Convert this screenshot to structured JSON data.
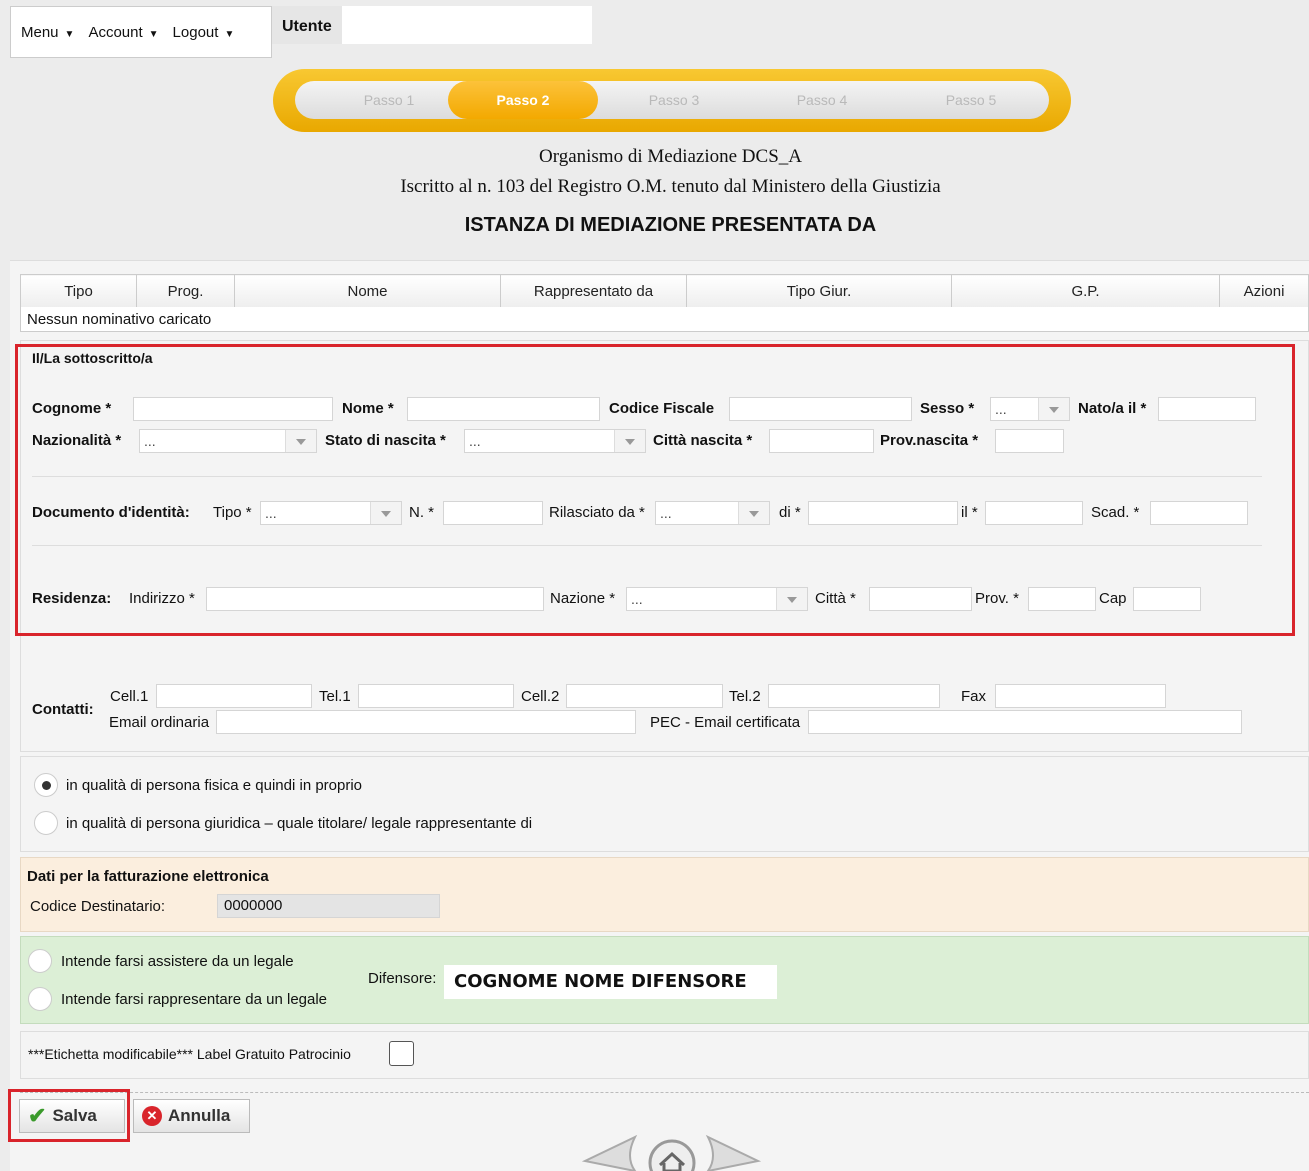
{
  "topbar": {
    "menu": "Menu",
    "account": "Account",
    "logout": "Logout",
    "utente": "Utente"
  },
  "steps": [
    "Passo 1",
    "Passo 2",
    "Passo 3",
    "Passo 4",
    "Passo 5"
  ],
  "header": {
    "line1": "Organismo di Mediazione DCS_A",
    "line2": "Iscritto al n. 103 del Registro O.M. tenuto dal Ministero della Giustizia",
    "title": "ISTANZA DI MEDIAZIONE PRESENTATA DA"
  },
  "table": {
    "columns": [
      "Tipo",
      "Prog.",
      "Nome",
      "Rappresentato da",
      "Tipo Giur.",
      "G.P.",
      "Azioni"
    ],
    "empty": "Nessun nominativo caricato"
  },
  "form": {
    "section_title": "Il/La sottoscritto/a",
    "cognome": "Cognome *",
    "nome": "Nome *",
    "cf": "Codice Fiscale",
    "sesso": "Sesso *",
    "nato": "Nato/a il *",
    "nazionalita": "Nazionalità *",
    "stato": "Stato di nascita *",
    "citta_nascita": "Città nascita *",
    "prov_nascita": "Prov.nascita *",
    "doc": "Documento d'identità:",
    "tipo": "Tipo *",
    "n": "N. *",
    "rilasciato": "Rilasciato da *",
    "di": "di *",
    "il": "il *",
    "scad": "Scad. *",
    "residenza": "Residenza:",
    "indirizzo": "Indirizzo *",
    "nazione": "Nazione *",
    "citta": "Città *",
    "prov": "Prov. *",
    "cap": "Cap",
    "select_placeholder": "..."
  },
  "contatti": {
    "label": "Contatti:",
    "cell1": "Cell.1",
    "tel1": "Tel.1",
    "cell2": "Cell.2",
    "tel2": "Tel.2",
    "fax": "Fax",
    "email": "Email ordinaria",
    "pec": "PEC - Email certificata"
  },
  "qualita": {
    "fisica": "in qualità di persona fisica e quindi in proprio",
    "giuridica": "in qualità di persona giuridica – quale titolare/ legale rappresentante di"
  },
  "fatturazione": {
    "title": "Dati per la fatturazione elettronica",
    "codice_label": "Codice Destinatario:",
    "codice_value": "0000000"
  },
  "legale": {
    "assistere": "Intende farsi assistere da un legale",
    "rappresentare": "Intende farsi rappresentare da un legale",
    "difensore_label": "Difensore:",
    "difensore_value": "COGNOME NOME DIFENSORE"
  },
  "gratuito": {
    "label": "***Etichetta modificabile*** Label Gratuito Patrocinio"
  },
  "buttons": {
    "salva": "Salva",
    "annulla": "Annulla"
  },
  "colors": {
    "accent": "#f3a900",
    "red": "#d9242b",
    "fatt_bg": "#fbeede",
    "legale_bg": "#dcefd6"
  }
}
